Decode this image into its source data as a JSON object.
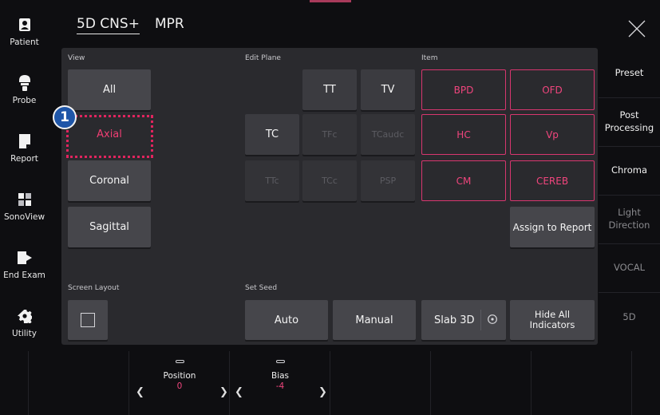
{
  "left_nav": [
    {
      "label": "Patient",
      "icon": "patient-icon"
    },
    {
      "label": "Probe",
      "icon": "probe-icon"
    },
    {
      "label": "Report",
      "icon": "report-icon"
    },
    {
      "label": "SonoView",
      "icon": "sonoview-icon"
    },
    {
      "label": "End Exam",
      "icon": "end-exam-icon"
    },
    {
      "label": "Utility",
      "icon": "gear-icon"
    }
  ],
  "header": {
    "mode1": "5D CNS+",
    "mode2": "MPR"
  },
  "right_nav": [
    {
      "label": "Preset"
    },
    {
      "label": "Post\nProcessing"
    },
    {
      "label": "Chroma"
    },
    {
      "label": "Light\nDirection"
    },
    {
      "label": "VOCAL"
    },
    {
      "label": "5D"
    }
  ],
  "sections": {
    "view": "View",
    "edit_plane": "Edit Plane",
    "item": "Item",
    "screen_layout": "Screen Layout",
    "set_seed": "Set Seed"
  },
  "view_buttons": [
    "All",
    "Axial",
    "Coronal",
    "Sagittal"
  ],
  "edit_plane": {
    "tt": "TT",
    "tv": "TV",
    "tc": "TC",
    "tfc": "TFc",
    "tcaudc": "TCaudc",
    "ttc": "TTc",
    "tcc": "TCc",
    "psp": "PSP"
  },
  "items": [
    "BPD",
    "OFD",
    "HC",
    "Vp",
    "CM",
    "CEREB"
  ],
  "assign_to_report": "Assign to Report",
  "seed": {
    "auto": "Auto",
    "manual": "Manual"
  },
  "slab3d": "Slab 3D",
  "hide_all": "Hide All\nIndicators",
  "callout": "1",
  "bottom": {
    "position": {
      "label": "Position",
      "value": "0"
    },
    "bias": {
      "label": "Bias",
      "value": "-4"
    }
  },
  "colors": {
    "accent": "#f0457d",
    "badge": "#1f56a8",
    "panel": "#2a2a2e",
    "button": "#46464b"
  }
}
